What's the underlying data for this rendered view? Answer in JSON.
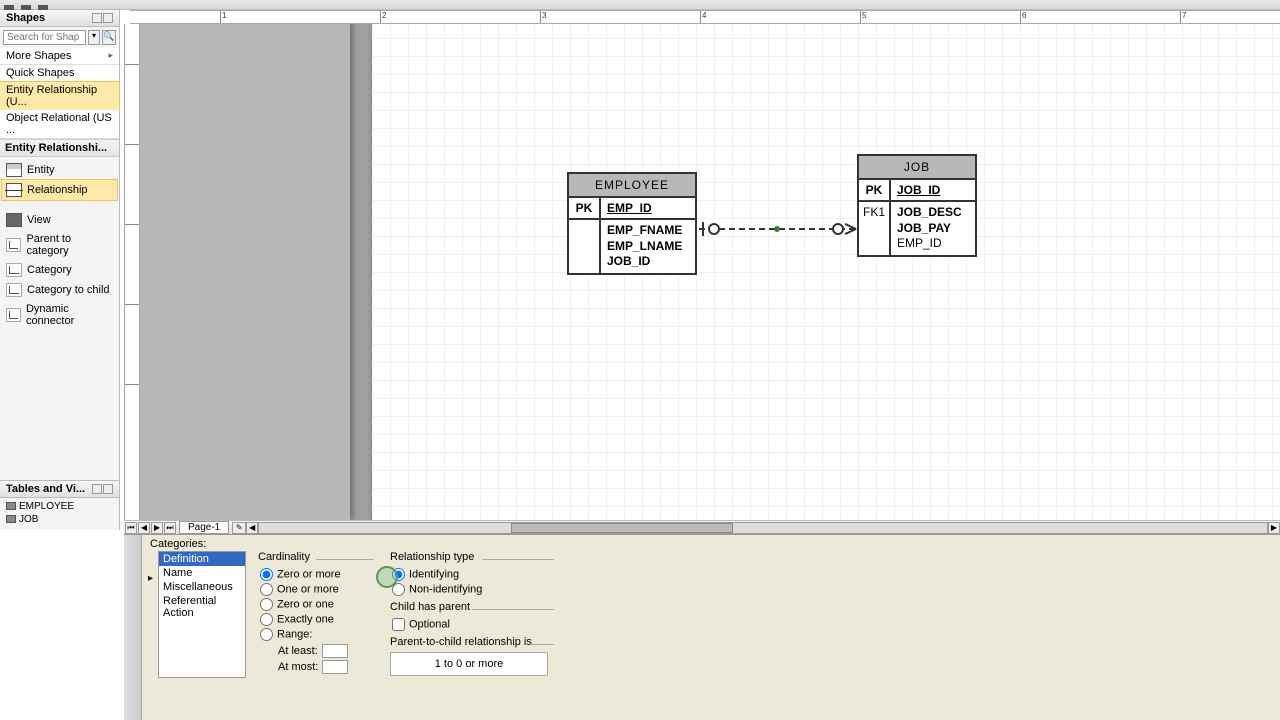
{
  "shapesPanel": {
    "title": "Shapes",
    "searchPlaceholder": "Search for Shap",
    "categories": [
      "More Shapes",
      "Quick Shapes",
      "Entity Relationship (U...",
      "Object Relational (US ..."
    ],
    "selectedCategoryIndex": 2,
    "subhead": "Entity Relationshi...",
    "shapes": [
      "Entity",
      "Relationship",
      "View",
      "Parent to category",
      "Category",
      "Category to child",
      "Dynamic connector"
    ],
    "selectedShapeIndex": 1
  },
  "tablesPanel": {
    "title": "Tables and Vi...",
    "items": [
      "EMPLOYEE",
      "JOB"
    ]
  },
  "pageTabs": {
    "active": "Page-1"
  },
  "diagram": {
    "entities": [
      {
        "name": "EMPLOYEE",
        "pk": "EMP_ID",
        "pkLabel": "PK",
        "attrs": [
          "EMP_FNAME",
          "EMP_LNAME",
          "JOB_ID"
        ],
        "keys": []
      },
      {
        "name": "JOB",
        "pk": "JOB_ID",
        "pkLabel": "PK",
        "attrs": [
          "JOB_DESC",
          "JOB_PAY",
          "EMP_ID"
        ],
        "keys": [
          "",
          "",
          "FK1"
        ]
      }
    ]
  },
  "properties": {
    "categoriesLabel": "Categories:",
    "categories": [
      "Definition",
      "Name",
      "Miscellaneous",
      "Referential Action"
    ],
    "selectedCategory": "Definition",
    "cardinality": {
      "label": "Cardinality",
      "options": [
        "Zero or more",
        "One or more",
        "Zero or one",
        "Exactly one",
        "Range:"
      ],
      "selected": "Zero or more",
      "atLeastLabel": "At least:",
      "atMostLabel": "At most:",
      "atLeast": "",
      "atMost": ""
    },
    "relationshipType": {
      "label": "Relationship type",
      "options": [
        "Identifying",
        "Non-identifying"
      ],
      "selected": "Identifying"
    },
    "childHasParent": {
      "label": "Child has parent",
      "optionalLabel": "Optional",
      "optional": false
    },
    "parentToChild": {
      "label": "Parent-to-child relationship is",
      "preview": "1  to  0 or more"
    }
  }
}
